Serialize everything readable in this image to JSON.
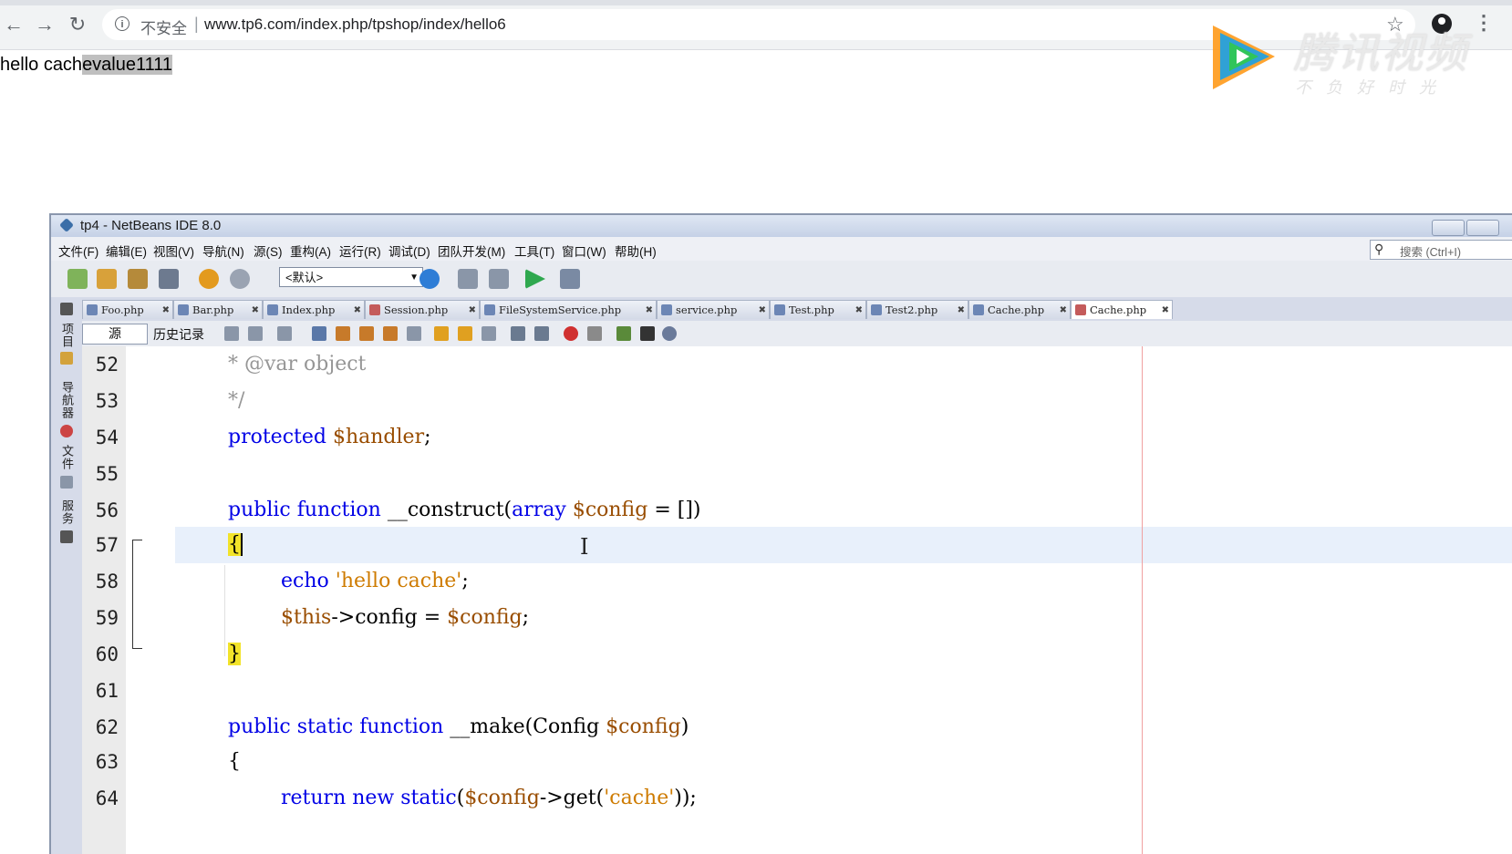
{
  "browser": {
    "back_icon": "back-arrow-icon",
    "forward_icon": "forward-arrow-icon",
    "reload_icon": "reload-icon",
    "security_label": "不安全",
    "url": "www.tp6.com/index.php/tpshop/index/hello6"
  },
  "page": {
    "text_plain": "hello cach",
    "text_selected": "evalue1111"
  },
  "watermark": {
    "title": "腾讯视频",
    "slogan": "不负好时光"
  },
  "ide": {
    "title": "tp4 - NetBeans IDE 8.0",
    "menu": [
      "文件(F)",
      "编辑(E)",
      "视图(V)",
      "导航(N)",
      "源(S)",
      "重构(A)",
      "运行(R)",
      "调试(D)",
      "团队开发(M)",
      "工具(T)",
      "窗口(W)",
      "帮助(H)"
    ],
    "search_placeholder": "搜索 (Ctrl+I)",
    "config_select": "<默认>",
    "side_tabs": [
      "项目",
      "导航器",
      "文件",
      "服务"
    ],
    "tabs": [
      {
        "label": "Foo.php",
        "active": false
      },
      {
        "label": "Bar.php",
        "active": false
      },
      {
        "label": "Index.php",
        "active": false
      },
      {
        "label": "Session.php",
        "active": false
      },
      {
        "label": "FileSystemService.php",
        "active": false
      },
      {
        "label": "service.php",
        "active": false
      },
      {
        "label": "Test.php",
        "active": false
      },
      {
        "label": "Test2.php",
        "active": false
      },
      {
        "label": "Cache.php",
        "active": false
      },
      {
        "label": "Cache.php",
        "active": true
      }
    ],
    "editor_source_btn": "源",
    "editor_history_btn": "历史记录"
  },
  "code": {
    "line_numbers": [
      "52",
      "53",
      "54",
      "55",
      "56",
      "57",
      "58",
      "59",
      "60",
      "61",
      "62",
      "63",
      "64"
    ],
    "caret_line": "57"
  }
}
